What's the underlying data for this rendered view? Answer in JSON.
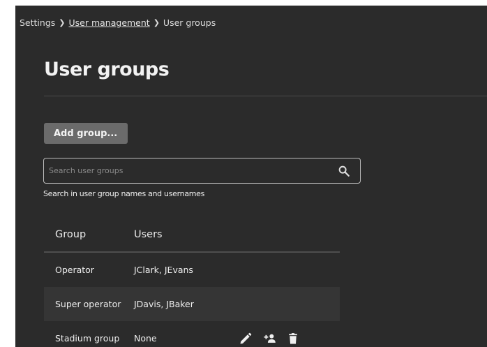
{
  "breadcrumb": {
    "items": [
      "Settings",
      "User management",
      "User groups"
    ],
    "separator": ">"
  },
  "page": {
    "title": "User groups"
  },
  "actions": {
    "add_group_label": "Add group..."
  },
  "search": {
    "placeholder": "Search user groups",
    "value": "",
    "icon": "search-icon",
    "helper_text": "Search in user group names and usernames"
  },
  "table": {
    "headers": [
      "Group",
      "Users"
    ],
    "rows": [
      {
        "group": "Operator",
        "users": "JClark, JEvans"
      },
      {
        "group": "Super operator",
        "users": "JDavis, JBaker"
      },
      {
        "group": "Stadium group",
        "users": "None",
        "actions": [
          "edit-icon",
          "add-user-icon",
          "delete-icon"
        ]
      }
    ]
  },
  "colors": {
    "background": "#2b2b2b",
    "button": "#6b6b6b",
    "row_highlight": "#353535",
    "text": "#e6e6e6"
  }
}
